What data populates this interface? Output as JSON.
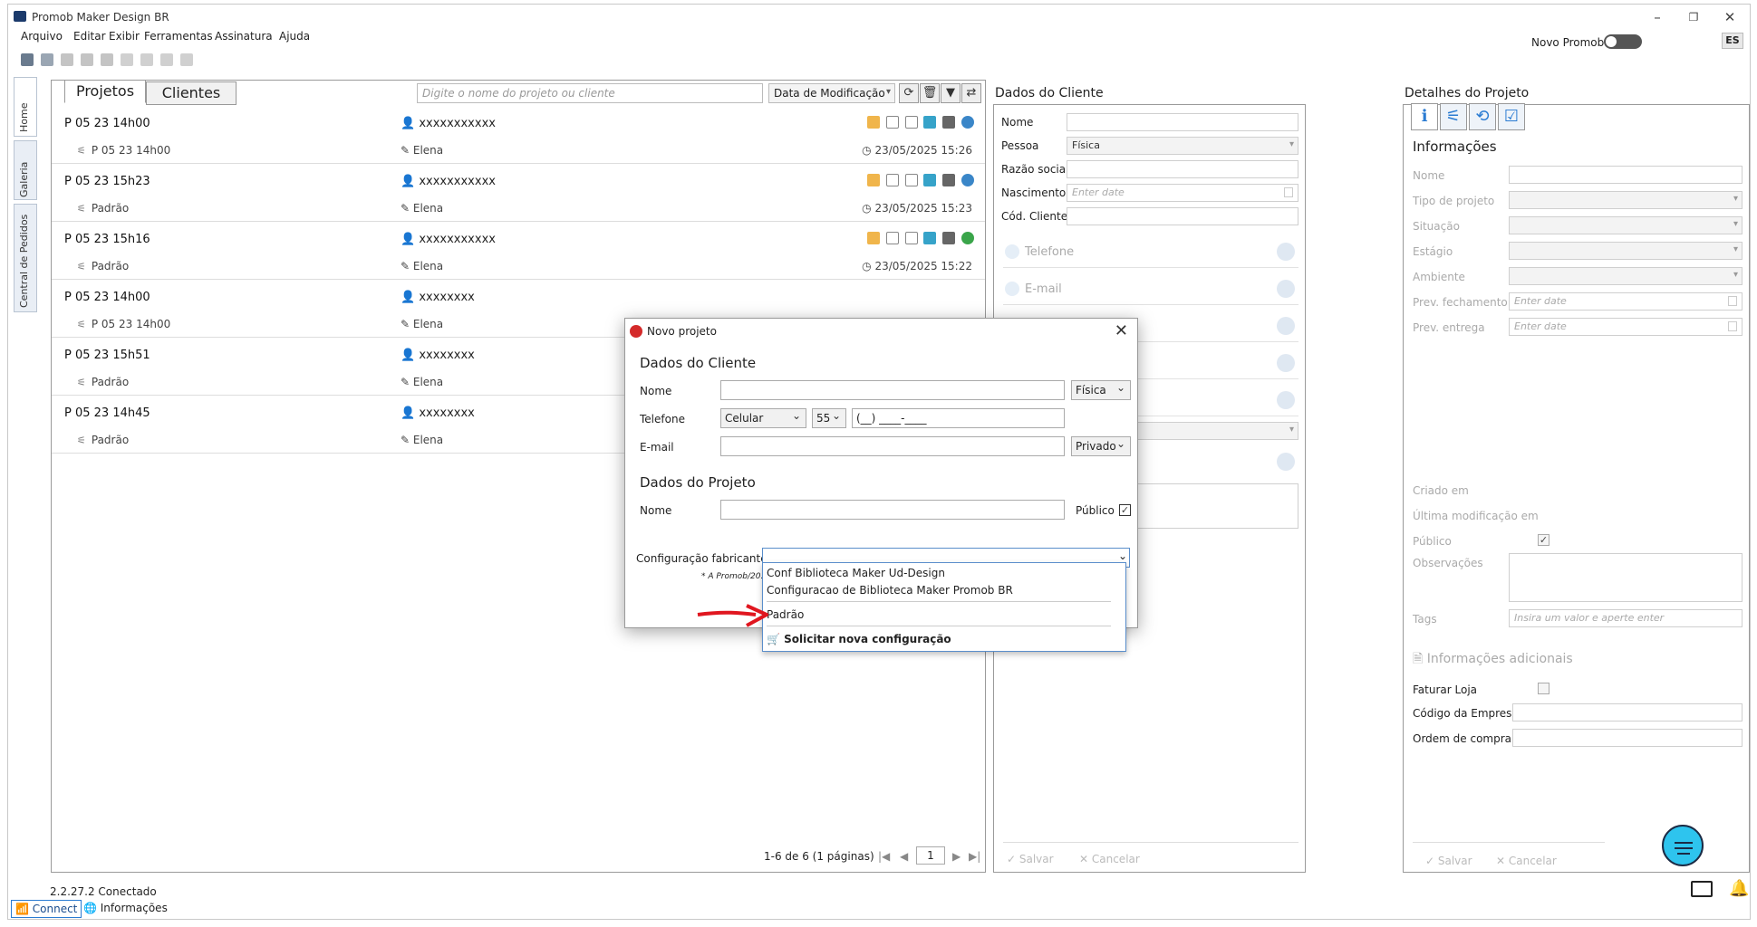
{
  "app": {
    "title": "Promob Maker Design BR"
  },
  "menu": [
    "Arquivo",
    "Editar",
    "Exibir",
    "Ferramentas",
    "Assinatura",
    "Ajuda"
  ],
  "header": {
    "novo_promob_label": "Novo Promob",
    "lang_badge": "ES"
  },
  "side_tabs": [
    "Home",
    "Galeria",
    "Central de Pedidos"
  ],
  "projects_panel": {
    "tabs": [
      "Projetos",
      "Clientes"
    ],
    "search_placeholder": "Digite o nome do projeto ou cliente",
    "sort_label": "Data de Modificação",
    "rows": [
      {
        "name": "P 05 23 14h00",
        "config": "P 05 23 14h00",
        "client": "xxxxxxxxxxx",
        "user": "Elena",
        "date": "23/05/2025 15:26",
        "cloud_color": "#3a86c8"
      },
      {
        "name": "P 05 23 15h23",
        "config": "Padrão",
        "client": "xxxxxxxxxxx",
        "user": "Elena",
        "date": "23/05/2025 15:23",
        "cloud_color": "#3a86c8"
      },
      {
        "name": "P 05 23 15h16",
        "config": "Padrão",
        "client": "xxxxxxxxxxx",
        "user": "Elena",
        "date": "23/05/2025 15:22",
        "cloud_color": "#3aa54a"
      },
      {
        "name": "P 05 23 14h00",
        "config": "P 05 23 14h00",
        "client": "xxxxxxxx",
        "user": "Elena",
        "date": "",
        "cloud_color": ""
      },
      {
        "name": "P 05 23 15h51",
        "config": "Padrão",
        "client": "xxxxxxxx",
        "user": "Elena",
        "date": "",
        "cloud_color": ""
      },
      {
        "name": "P 05 23 14h45",
        "config": "Padrão",
        "client": "xxxxxxxx",
        "user": "Elena",
        "date": "",
        "cloud_color": ""
      }
    ],
    "pager": {
      "summary": "1-6 de 6 (1 páginas)",
      "page": "1"
    }
  },
  "client_panel": {
    "title": "Dados do Cliente",
    "fields": {
      "nome": "Nome",
      "pessoa": "Pessoa",
      "pessoa_value": "Física",
      "razao": "Razão social",
      "nascimento": "Nascimento",
      "nascimento_placeholder": "Enter date",
      "cod": "Cód. Cliente"
    },
    "sections": [
      "Telefone",
      "E-mail"
    ],
    "save": "Salvar",
    "cancel": "Cancelar"
  },
  "project_details": {
    "title": "Detalhes do Projeto",
    "info_title": "Informações",
    "fields": [
      "Nome",
      "Tipo de projeto",
      "Situação",
      "Estágio",
      "Ambiente",
      "Prev. fechamento",
      "Prev. entrega"
    ],
    "date_placeholder": "Enter date",
    "meta": [
      "Criado em",
      "Última modificação em",
      "Público",
      "Observações",
      "Tags"
    ],
    "tags_placeholder": "Insira um valor e aperte enter",
    "extra_title": "Informações adicionais",
    "extra_fields": [
      "Faturar Loja",
      "Código da Empresa",
      "Ordem de compra"
    ],
    "save": "Salvar",
    "cancel": "Cancelar"
  },
  "dialog": {
    "title": "Novo projeto",
    "client_section": "Dados do Cliente",
    "nome_label": "Nome",
    "pessoa_value": "Física",
    "telefone_label": "Telefone",
    "phone_type": "Celular",
    "phone_code": "55",
    "phone_mask": "(__) ____-____",
    "email_label": "E-mail",
    "email_privacy": "Privado",
    "project_section": "Dados do Projeto",
    "project_nome_label": "Nome",
    "publico_label": "Público",
    "config_label": "Configuração fabricante *",
    "note": "* A Promob/20..."
  },
  "config_options": {
    "items": [
      "Conf Biblioteca Maker Ud-Design",
      "Configuracao de Biblioteca Maker Promob BR",
      "Padrão"
    ],
    "request": "Solicitar nova configuração"
  },
  "status": {
    "version": "2.2.27.2 Conectado"
  },
  "bottom_bar": {
    "connect": "Connect",
    "info": "Informações"
  },
  "colors": {
    "accent": "#2a7bd2",
    "arrow": "#e0161f",
    "fab": "#2ec4ee"
  }
}
